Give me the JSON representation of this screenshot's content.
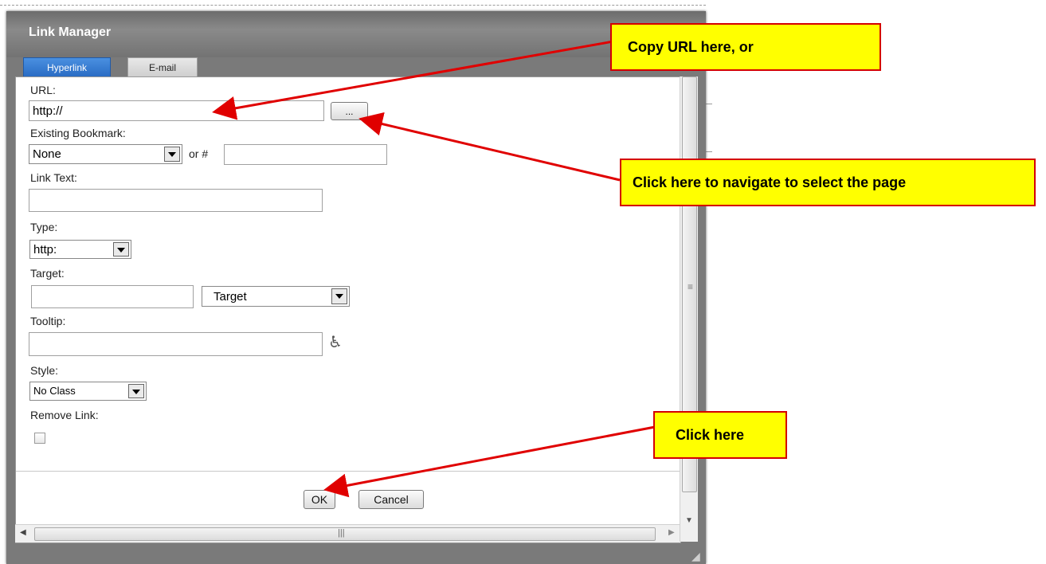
{
  "dialog": {
    "title": "Link Manager",
    "tabs": [
      {
        "label": "Hyperlink",
        "active": true
      },
      {
        "label": "E-mail",
        "active": false
      }
    ]
  },
  "form": {
    "url_label": "URL:",
    "url_value": "http://",
    "browse_button": "...",
    "bookmark_label": "Existing Bookmark:",
    "bookmark_value": "None",
    "or_hash": "or #",
    "bookmark_hash_value": "",
    "link_text_label": "Link Text:",
    "link_text_value": "",
    "type_label": "Type:",
    "type_value": "http:",
    "target_label": "Target:",
    "target_value": "",
    "target_select_value": "Target",
    "tooltip_label": "Tooltip:",
    "tooltip_value": "",
    "style_label": "Style:",
    "style_value": "No Class",
    "remove_link_label": "Remove Link:",
    "remove_link_checked": false
  },
  "footer": {
    "ok_label": "OK",
    "cancel_label": "Cancel"
  },
  "annotations": {
    "callout_url": "Copy URL here, or",
    "callout_browse": "Click here to navigate to select the page",
    "callout_ok": "Click here",
    "callout_bg": "#ffff00",
    "callout_border": "#d40000",
    "arrow_color": "#e00000"
  }
}
